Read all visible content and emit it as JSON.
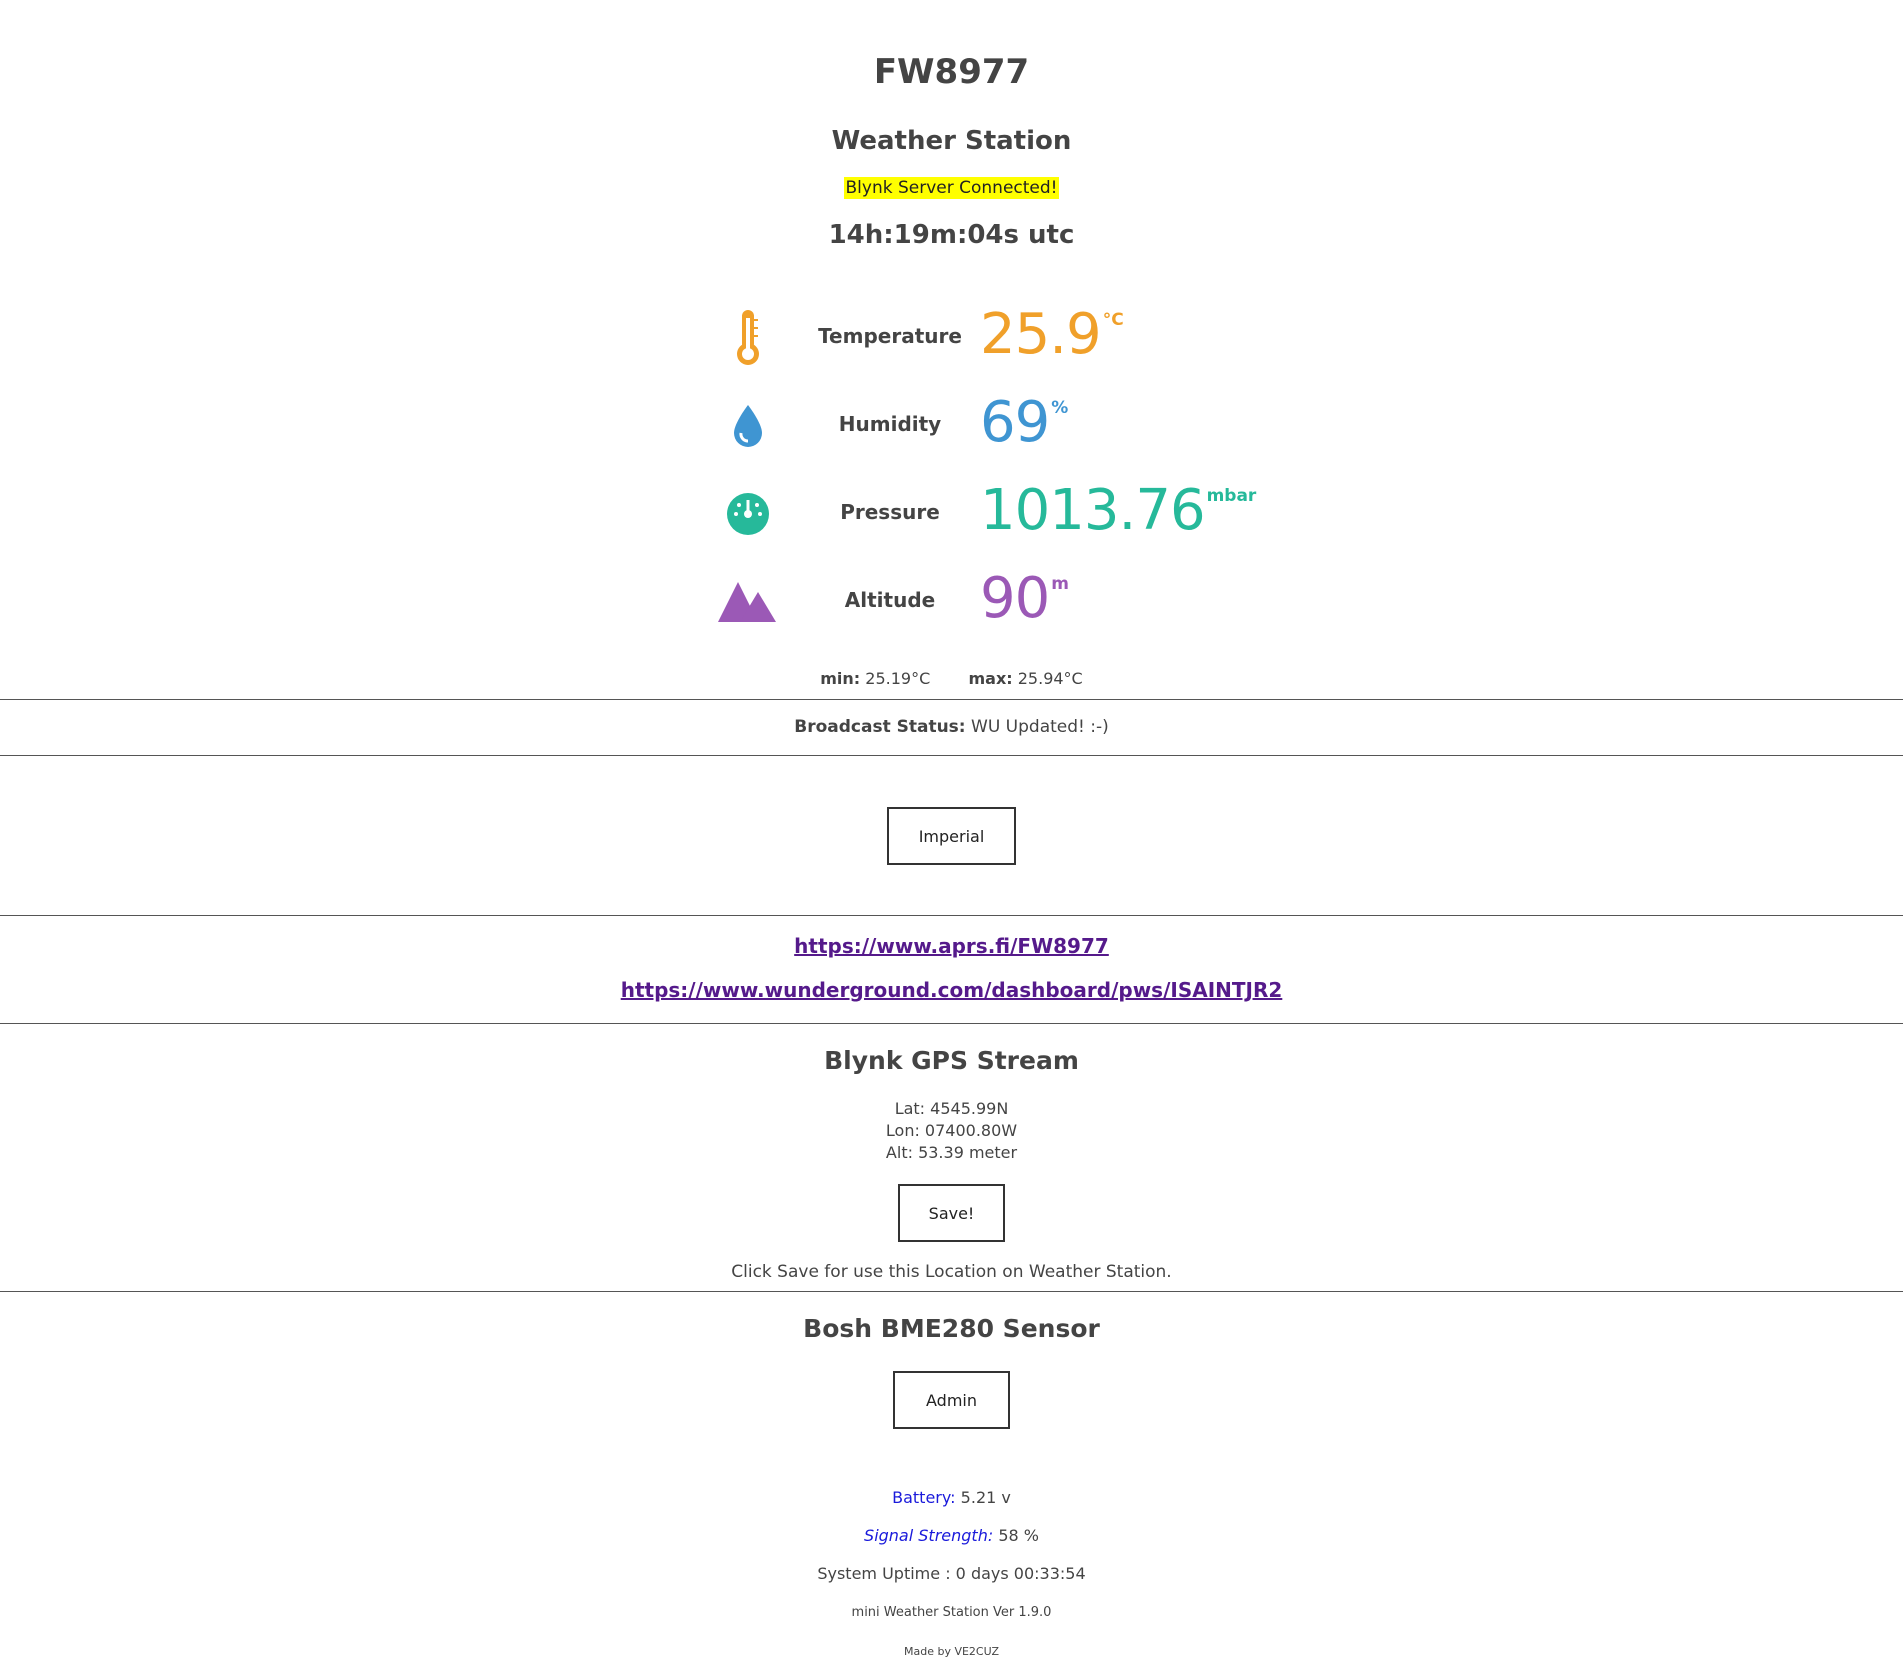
{
  "header": {
    "station_id": "FW8977",
    "subtitle": "Weather Station",
    "blynk_status": "Blynk Server Connected!",
    "clock": "14h:19m:04s utc"
  },
  "readings": [
    {
      "label": "Temperature",
      "value": "25.9",
      "unit": "°C",
      "icon": "thermometer-icon",
      "color": "#f0a02a"
    },
    {
      "label": "Humidity",
      "value": "69",
      "unit": "%",
      "icon": "water-drop-icon",
      "color": "#3f95d2"
    },
    {
      "label": "Pressure",
      "value": "1013.76",
      "unit": "mbar",
      "icon": "gauge-icon",
      "color": "#26b99a"
    },
    {
      "label": "Altitude",
      "value": "90",
      "unit": "m",
      "icon": "mountain-icon",
      "color": "#9b59b6"
    }
  ],
  "minmax": {
    "min_label": "min:",
    "min_value": "25.19°C",
    "max_label": "max:",
    "max_value": "25.94°C"
  },
  "broadcast": {
    "label": "Broadcast Status:",
    "value": "WU Updated! :-)"
  },
  "units_button": "Imperial",
  "links": {
    "aprs": "https://www.aprs.fi/FW8977",
    "wunderground": "https://www.wunderground.com/dashboard/pws/ISAINTJR2"
  },
  "gps": {
    "title": "Blynk GPS Stream",
    "lat": "Lat: 4545.99N",
    "lon": "Lon: 07400.80W",
    "alt": "Alt: 53.39 meter",
    "save_button": "Save!",
    "note": "Click Save for use this Location on Weather Station."
  },
  "sensor": {
    "title": "Bosh BME280 Sensor",
    "admin_button": "Admin"
  },
  "system": {
    "battery_label": "Battery:",
    "battery_value": "5.21 v",
    "signal_label": "Signal Strength:",
    "signal_value": "58 %",
    "uptime": "System Uptime : 0 days 00:33:54",
    "version": "mini Weather Station Ver 1.9.0",
    "credit": "Made by VE2CUZ"
  }
}
